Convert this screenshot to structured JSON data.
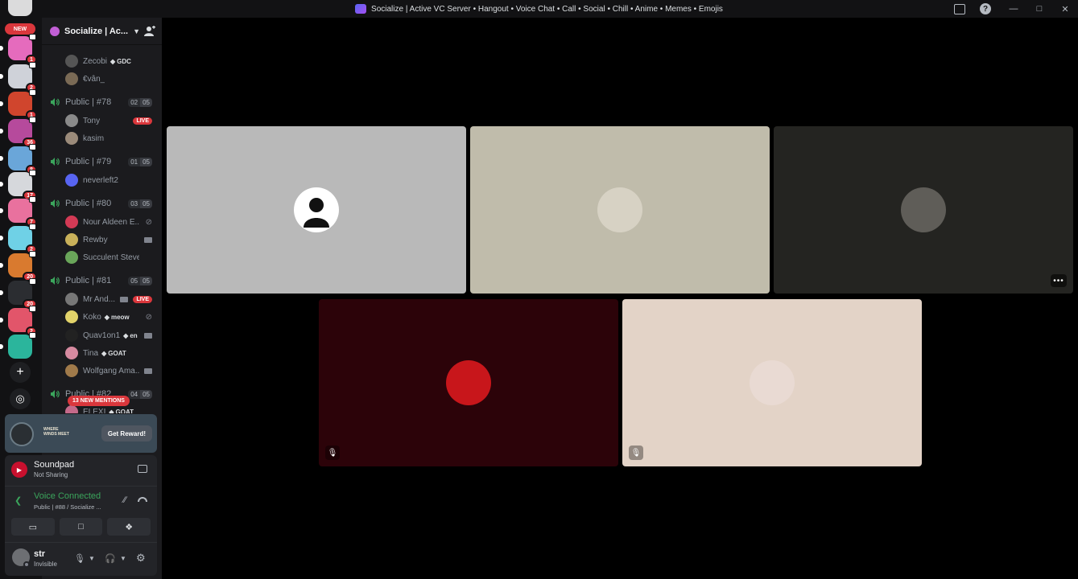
{
  "window": {
    "title": "Socialize | Active VC Server • Hangout • Voice Chat • Call • Social • Chill • Anime • Memes • Emojis",
    "help_icon": "?"
  },
  "rail": {
    "new_label": "NEW",
    "servers": [
      {
        "badge": "1",
        "color": "#e56bbd"
      },
      {
        "badge": "2",
        "color": "#cfd2d9"
      },
      {
        "badge": "1",
        "color": "#d0452d"
      },
      {
        "badge": "36",
        "color": "#b64a9c"
      },
      {
        "badge": "8",
        "color": "#6aa6d9"
      },
      {
        "badge": "17",
        "color": "#d6d8dc"
      },
      {
        "badge": "7",
        "color": "#e9719e"
      },
      {
        "badge": "2",
        "color": "#6fd1e6"
      },
      {
        "badge": "20",
        "color": "#d97a2f"
      },
      {
        "badge": "20",
        "color": "#2b2d31"
      },
      {
        "badge": "2",
        "color": "#e2556a"
      },
      {
        "badge": "",
        "color": "#2bb59c"
      }
    ],
    "add_server_icon": "+",
    "discover_icon": "◎"
  },
  "sidebar": {
    "server_name": "Socialize | Ac...",
    "channels": [
      {
        "type": "user",
        "name": "Zecobi",
        "tag": "GDC",
        "avatar": "#555"
      },
      {
        "type": "user",
        "name": "€vân_",
        "avatar": "#7a6a55"
      },
      {
        "type": "vc",
        "name": "Public | #78",
        "cnt1": "02",
        "cnt2": "05"
      },
      {
        "type": "user",
        "name": "Tony",
        "live": "LIVE",
        "avatar": "#8a8a8a"
      },
      {
        "type": "user",
        "name": "kasim",
        "avatar": "#9b8b7a"
      },
      {
        "type": "vc",
        "name": "Public | #79",
        "cnt1": "01",
        "cnt2": "05"
      },
      {
        "type": "user",
        "name": "neverleft2",
        "avatar": "#5865f2"
      },
      {
        "type": "vc",
        "name": "Public | #80",
        "cnt1": "03",
        "cnt2": "05"
      },
      {
        "type": "user",
        "name": "Nour Aldeen E...",
        "avatar": "#d33a55",
        "icon": "mute"
      },
      {
        "type": "user",
        "name": "Rewby",
        "avatar": "#c9b15a",
        "icon": "cam"
      },
      {
        "type": "user",
        "name": "Succulent Steve",
        "avatar": "#6aa65a"
      },
      {
        "type": "vc",
        "name": "Public | #81",
        "cnt1": "05",
        "cnt2": "05"
      },
      {
        "type": "user",
        "name": "Mr And...",
        "avatar": "#777",
        "live": "LIVE",
        "icon": "cam2"
      },
      {
        "type": "user",
        "name": "Koko",
        "tag": "meow",
        "avatar": "#e2d36a",
        "icon": "mute"
      },
      {
        "type": "user",
        "name": "Quav1on1",
        "tag": "en",
        "avatar": "#222",
        "icon": "cam"
      },
      {
        "type": "user",
        "name": "Tina",
        "tag": "GOAT",
        "avatar": "#d68aa0"
      },
      {
        "type": "user",
        "name": "Wolfgang Ama...",
        "avatar": "#a07a4a",
        "icon": "cam"
      },
      {
        "type": "vc",
        "name": "Public | #82",
        "cnt1": "04",
        "cnt2": "05"
      },
      {
        "type": "user",
        "name": "ELEXI",
        "tag": "GOAT",
        "avatar": "#c56a8a"
      }
    ],
    "new_mentions": "13 NEW MENTIONS"
  },
  "promo": {
    "logo_text_1": "WHERE",
    "logo_text_2": "WINDS MEET",
    "button": "Get Reward!"
  },
  "soundpad": {
    "title": "Soundpad",
    "subtitle": "Not Sharing"
  },
  "voice": {
    "title": "Voice Connected",
    "subtitle": "Public | #88 / Socialize ..."
  },
  "user": {
    "name": "str",
    "status": "Invisible"
  },
  "tiles": [
    {
      "bg": "#b9b9b9",
      "avatar": "#ffffff",
      "muted": false,
      "more": false
    },
    {
      "bg": "#c0bcab",
      "avatar": "#d7d2c4",
      "muted": false,
      "more": false
    },
    {
      "bg": "#242421",
      "avatar": "#5f5d58",
      "muted": false,
      "more": true
    },
    {
      "bg": "#2c0309",
      "avatar": "#c8161b",
      "muted": true,
      "more": false
    },
    {
      "bg": "#e3d3c7",
      "avatar": "#e9dad3",
      "muted": true,
      "more": false
    }
  ]
}
